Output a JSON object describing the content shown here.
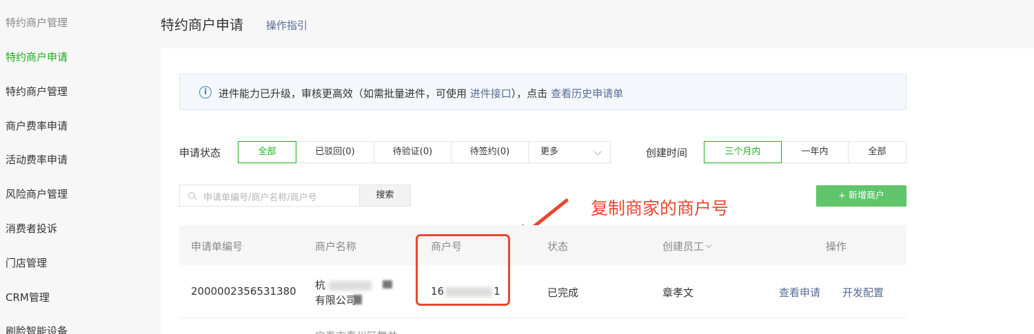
{
  "sidebar": {
    "items": [
      {
        "label": "特约商户管理",
        "kind": "group"
      },
      {
        "label": "特约商户申请",
        "kind": "active"
      },
      {
        "label": "特约商户管理",
        "kind": "normal"
      },
      {
        "label": "商户费率申请",
        "kind": "normal"
      },
      {
        "label": "活动费率申请",
        "kind": "normal"
      },
      {
        "label": "风险商户管理",
        "kind": "normal"
      },
      {
        "label": "消费者投诉",
        "kind": "normal"
      },
      {
        "label": "门店管理",
        "kind": "normal"
      },
      {
        "label": "CRM管理",
        "kind": "normal"
      },
      {
        "label": "刷脸智能设备",
        "kind": "normal"
      }
    ]
  },
  "header": {
    "title": "特约商户申请",
    "guide_link": "操作指引"
  },
  "notice": {
    "icon": "info-icon",
    "text_before": "进件能力已升级，审核更高效（如需批量进件，可使用 ",
    "link_api": "进件接口",
    "text_mid": "），点击 ",
    "link_history": "查看历史申请单"
  },
  "filters": {
    "status_label": "申请状态",
    "status_options": [
      "全部",
      "已驳回(0)",
      "待验证(0)",
      "待签约(0)",
      "更多"
    ],
    "status_selected": "全部",
    "time_label": "创建时间",
    "time_options": [
      "三个月内",
      "一年内",
      "全部"
    ],
    "time_selected": "三个月内"
  },
  "search": {
    "placeholder": "申请单编号/商户名称/商户号",
    "button": "搜索"
  },
  "add_button": "+ 新增商户",
  "annotation": {
    "text": "复制商家的商户号",
    "color": "#e8472f"
  },
  "table": {
    "headers": [
      "申请单编号",
      "商户名称",
      "商户号",
      "状态",
      "创建员工",
      "操作"
    ],
    "rows": [
      {
        "id": "2000002356531380",
        "name_line1": "杭",
        "name_line2": "有限公司",
        "merchant_no_prefix": "16",
        "merchant_no_suffix": "1",
        "status": "已完成",
        "creator": "章孝文",
        "actions": [
          "查看申请",
          "开发配置"
        ]
      }
    ],
    "next_row_partial": "宁春市春州区舞井"
  },
  "colors": {
    "accent": "#1aad19",
    "link": "#576b95",
    "annotation": "#e8472f",
    "add_button": "#5fc46a"
  }
}
